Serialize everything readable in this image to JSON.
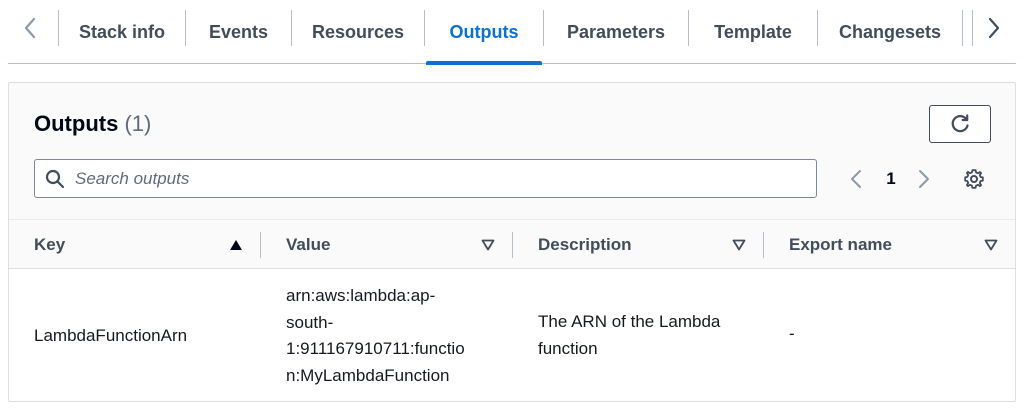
{
  "tabs": {
    "items": [
      {
        "label": "Stack info",
        "active": false
      },
      {
        "label": "Events",
        "active": false
      },
      {
        "label": "Resources",
        "active": false
      },
      {
        "label": "Outputs",
        "active": true
      },
      {
        "label": "Parameters",
        "active": false
      },
      {
        "label": "Template",
        "active": false
      },
      {
        "label": "Changesets",
        "active": false
      }
    ],
    "scroll_left_icon": "chevron-left-icon",
    "scroll_right_icon": "chevron-right-icon"
  },
  "panel": {
    "title": "Outputs",
    "count": "(1)",
    "refresh_icon": "refresh-icon"
  },
  "search": {
    "placeholder": "Search outputs",
    "value": ""
  },
  "pagination": {
    "current_page": "1",
    "prev_icon": "chevron-left-icon",
    "next_icon": "chevron-right-icon",
    "settings_icon": "gear-icon"
  },
  "table": {
    "columns": [
      {
        "label": "Key",
        "sort": "ascending"
      },
      {
        "label": "Value",
        "sort": "none"
      },
      {
        "label": "Description",
        "sort": "none"
      },
      {
        "label": "Export name",
        "sort": "none"
      }
    ],
    "rows": [
      {
        "key": "LambdaFunctionArn",
        "value_lines": [
          "arn:aws:lambda:ap-",
          "south-",
          "1:911167910711:functio",
          "n:MyLambdaFunction"
        ],
        "description_lines": [
          "The ARN of the Lambda",
          "function"
        ],
        "export_name": "-"
      }
    ]
  },
  "colors": {
    "accent": "#0972d3",
    "text": "#16191f",
    "muted": "#5f6b7a",
    "border": "#b6bec9"
  }
}
